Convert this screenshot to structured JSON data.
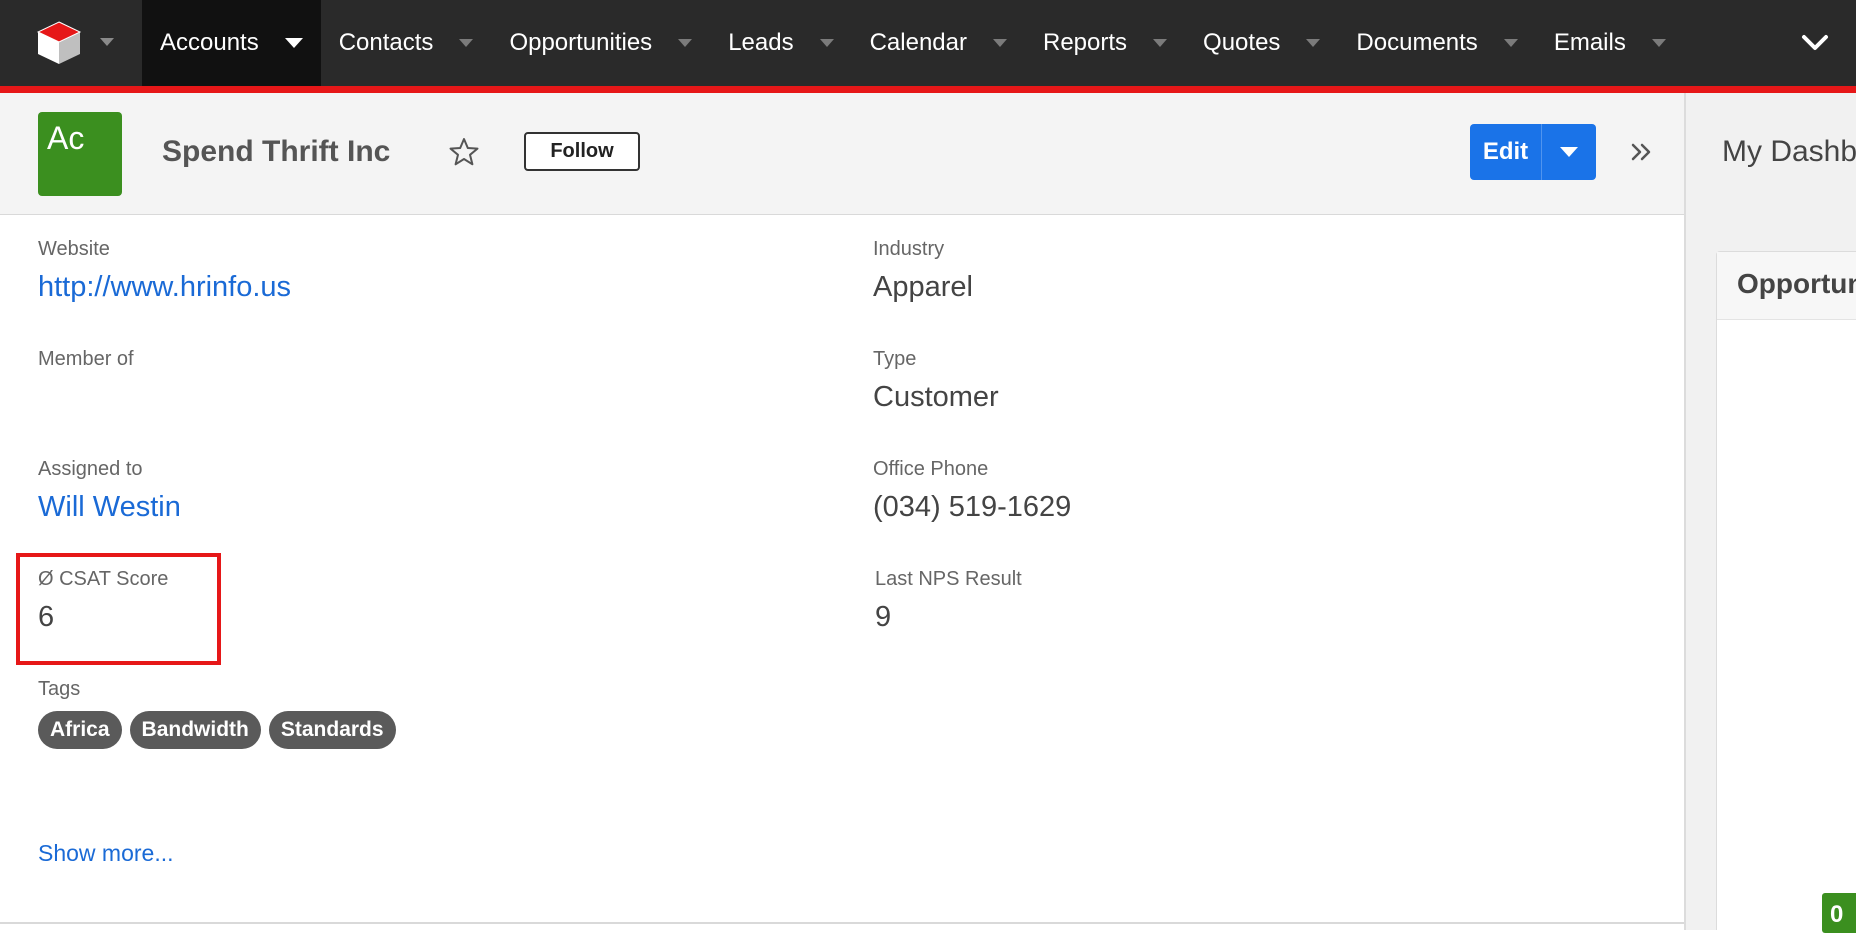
{
  "nav": {
    "items": [
      {
        "label": "Accounts",
        "active": true
      },
      {
        "label": "Contacts"
      },
      {
        "label": "Opportunities"
      },
      {
        "label": "Leads"
      },
      {
        "label": "Calendar"
      },
      {
        "label": "Reports"
      },
      {
        "label": "Quotes"
      },
      {
        "label": "Documents"
      },
      {
        "label": "Emails"
      }
    ],
    "accent_color": "#e61718"
  },
  "record": {
    "avatar_text": "Ac",
    "avatar_color": "#3b8f1f",
    "name": "Spend Thrift Inc",
    "follow_label": "Follow",
    "edit_label": "Edit"
  },
  "fields": {
    "website": {
      "label": "Website",
      "value": "http://www.hrinfo.us"
    },
    "member_of": {
      "label": "Member of",
      "value": ""
    },
    "assigned_to": {
      "label": "Assigned to",
      "value": "Will Westin"
    },
    "csat": {
      "label": "Ø CSAT Score",
      "value": "6"
    },
    "industry": {
      "label": "Industry",
      "value": "Apparel"
    },
    "type": {
      "label": "Type",
      "value": "Customer"
    },
    "office_phone": {
      "label": "Office Phone",
      "value": "(034) 519-1629"
    },
    "last_nps": {
      "label": "Last NPS Result",
      "value": "9"
    },
    "tags": {
      "label": "Tags",
      "values": [
        "Africa",
        "Bandwidth",
        "Standards"
      ]
    }
  },
  "show_more": "Show more...",
  "dashboard": {
    "title": "My Dashb",
    "card_title": "Opportun",
    "badge": "0"
  }
}
